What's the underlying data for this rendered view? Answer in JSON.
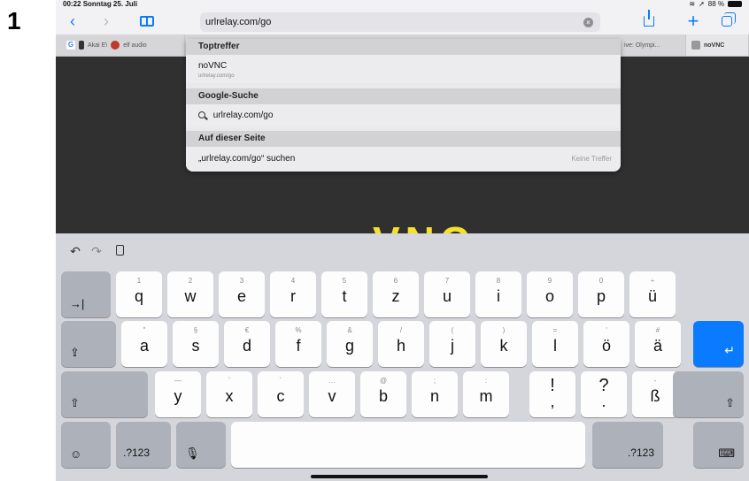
{
  "figure_number": "1",
  "status_bar": {
    "time": "00:22",
    "date": "Sonntag 25. Juli",
    "battery": "88 %"
  },
  "toolbar": {
    "back_label": "‹",
    "forward_label": "›",
    "address_value": "urlrelay.com/go",
    "new_tab_label": "+"
  },
  "tabs": [
    {
      "label": "Akai E\\",
      "label2": "elf audio"
    },
    {
      "label": "ive: Olympi..."
    },
    {
      "label": "noVNC"
    }
  ],
  "suggestions": {
    "top_hits_header": "Toptreffer",
    "top_hit_title": "noVNC",
    "top_hit_url": "urlrelay.com/go",
    "google_header": "Google-Suche",
    "google_query": "urlrelay.com/go",
    "on_page_header": "Auf dieser Seite",
    "on_page_query": "„urlrelay.com/go“ suchen",
    "on_page_note": "Keine Treffer"
  },
  "page": {
    "logo_text": "VNC"
  },
  "keyboard": {
    "row1": [
      {
        "hint": "1",
        "key": "q"
      },
      {
        "hint": "2",
        "key": "w"
      },
      {
        "hint": "3",
        "key": "e"
      },
      {
        "hint": "4",
        "key": "r"
      },
      {
        "hint": "5",
        "key": "t"
      },
      {
        "hint": "6",
        "key": "z"
      },
      {
        "hint": "7",
        "key": "u"
      },
      {
        "hint": "8",
        "key": "i"
      },
      {
        "hint": "9",
        "key": "o"
      },
      {
        "hint": "0",
        "key": "p"
      },
      {
        "hint": "÷",
        "key": "ü"
      }
    ],
    "row2": [
      {
        "hint": "\"",
        "key": "a"
      },
      {
        "hint": "§",
        "key": "s"
      },
      {
        "hint": "€",
        "key": "d"
      },
      {
        "hint": "%",
        "key": "f"
      },
      {
        "hint": "&",
        "key": "g"
      },
      {
        "hint": "/",
        "key": "h"
      },
      {
        "hint": "(",
        "key": "j"
      },
      {
        "hint": ")",
        "key": "k"
      },
      {
        "hint": "=",
        "key": "l"
      },
      {
        "hint": "'",
        "key": "ö"
      },
      {
        "hint": "#",
        "key": "ä"
      }
    ],
    "row3": [
      {
        "hint": "—",
        "key": "y"
      },
      {
        "hint": "`",
        "key": "x"
      },
      {
        "hint": "´",
        "key": "c"
      },
      {
        "hint": "…",
        "key": "v"
      },
      {
        "hint": "@",
        "key": "b"
      },
      {
        "hint": ";",
        "key": "n"
      },
      {
        "hint": ":",
        "key": "m"
      }
    ],
    "punct_keys": [
      {
        "top": "!",
        "bottom": ","
      },
      {
        "top": "?",
        "bottom": "."
      }
    ],
    "sharp_s": {
      "hint": "-",
      "key": "ß"
    },
    "numbers_label": ".?123",
    "numbers_label_right": ".?123"
  },
  "colors": {
    "accent": "#0a7aff",
    "logo_yellow": "#f5e12c"
  }
}
